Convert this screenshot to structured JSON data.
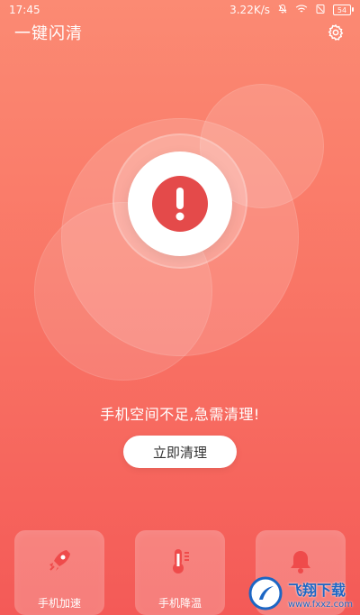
{
  "status": {
    "time": "17:45",
    "network_speed": "3.22K/s",
    "battery_level": "54"
  },
  "header": {
    "title": "一键闪清",
    "settings_icon": "gear-icon"
  },
  "main": {
    "alert_icon": "exclamation-icon",
    "message": "手机空间不足,急需清理!",
    "clean_button": "立即清理"
  },
  "cards": [
    {
      "label": "手机加速",
      "icon": "rocket-icon"
    },
    {
      "label": "手机降温",
      "icon": "thermometer-icon"
    },
    {
      "label": "",
      "icon": "bell-icon"
    }
  ],
  "watermark": {
    "name": "飞翔下载",
    "url": "www.fxxz.com"
  },
  "colors": {
    "background_top": "#fb8a73",
    "background_bottom": "#f45a57",
    "alert_red": "#e44a4a"
  }
}
